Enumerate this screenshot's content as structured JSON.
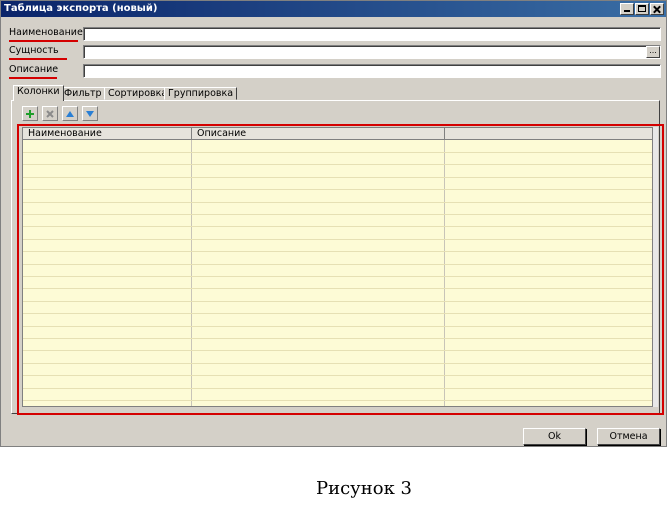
{
  "window": {
    "title": "Таблица экспорта (новый)"
  },
  "form": {
    "name_label": "Наименование",
    "entity_label": "Сущность",
    "description_label": "Описание",
    "name_value": "",
    "entity_value": "",
    "description_value": "",
    "browse_label": "..."
  },
  "tabs": [
    {
      "label": "Колонки",
      "active": true
    },
    {
      "label": "Фильтр",
      "active": false
    },
    {
      "label": "Сортировка",
      "active": false
    },
    {
      "label": "Группировка",
      "active": false
    }
  ],
  "toolbar": {
    "icons": [
      "add-icon",
      "delete-icon",
      "move-up-icon",
      "move-down-icon"
    ]
  },
  "grid": {
    "columns": [
      "Наименование",
      "Описание",
      ""
    ],
    "rows": []
  },
  "buttons": {
    "ok_label": "Ok",
    "cancel_label": "Отмена"
  },
  "caption": "Рисунок 3",
  "colors": {
    "highlight_red": "#d40000",
    "grid_background": "#fdfbd6",
    "dialog_background": "#d4d0c8"
  }
}
